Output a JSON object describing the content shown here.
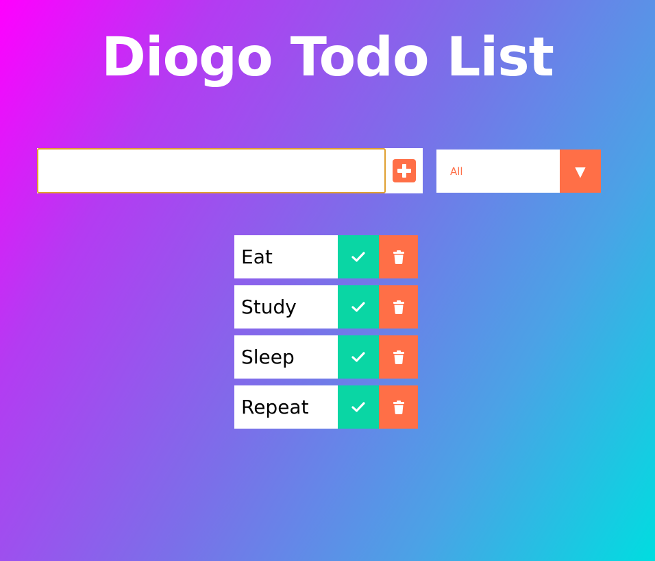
{
  "header": {
    "title": "Diogo Todo List"
  },
  "form": {
    "input_value": "",
    "input_placeholder": "",
    "add_icon": "plus-square-icon",
    "filter": {
      "selected": "All",
      "arrow_icon": "caret-down-icon"
    }
  },
  "todos": [
    {
      "text": "Eat"
    },
    {
      "text": "Study"
    },
    {
      "text": "Sleep"
    },
    {
      "text": "Repeat"
    }
  ],
  "colors": {
    "accent": "#ff6f47",
    "complete": "#0ad6a4",
    "gradient_start": "#ff00ff",
    "gradient_end": "#00dde0"
  }
}
